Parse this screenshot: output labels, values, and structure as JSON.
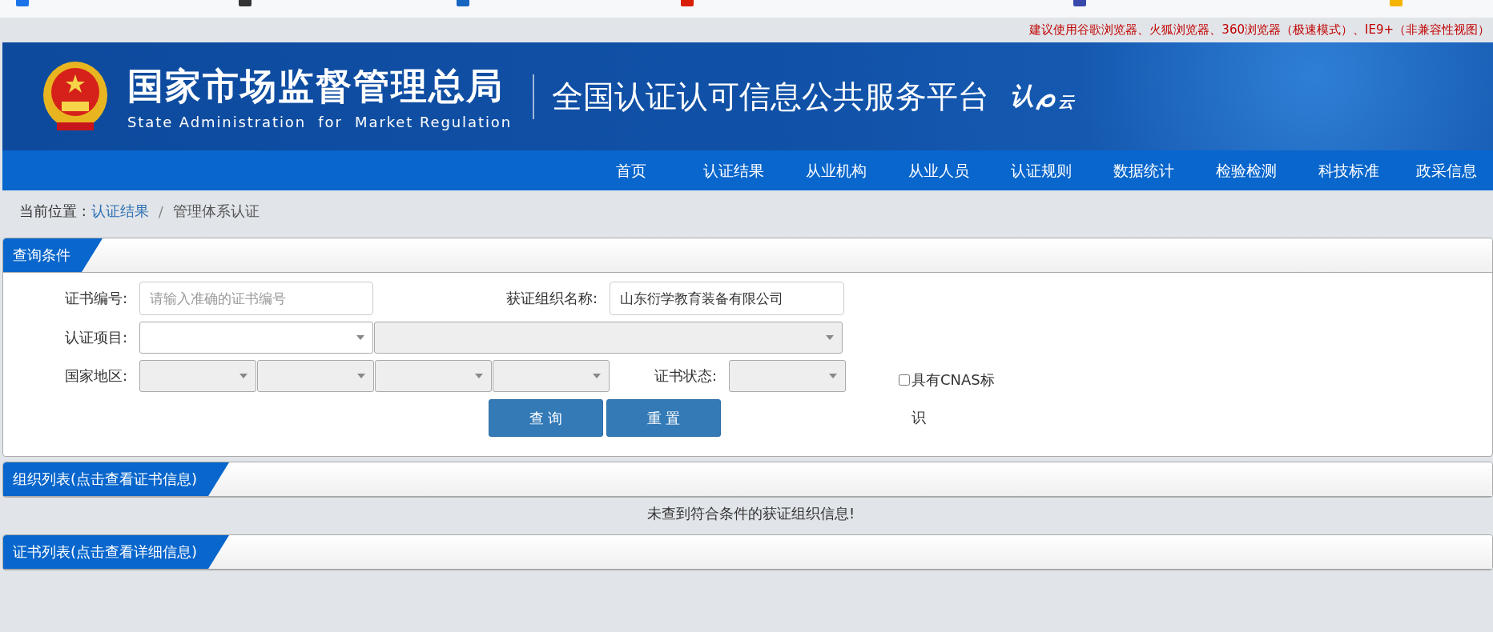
{
  "notice": "建议使用谷歌浏览器、火狐浏览器、360浏览器（极速模式）、IE9+（非兼容性视图）",
  "header": {
    "title": "国家市场监督管理总局",
    "subtitle": "State Administration  for  Market Regulation",
    "platform": "全国认证认可信息公共服务平台",
    "logo_text": [
      "认",
      "云"
    ]
  },
  "nav": [
    {
      "label": "首页"
    },
    {
      "label": "认证结果"
    },
    {
      "label": "从业机构"
    },
    {
      "label": "从业人员"
    },
    {
      "label": "认证规则"
    },
    {
      "label": "数据统计"
    },
    {
      "label": "检验检测"
    },
    {
      "label": "科技标准"
    },
    {
      "label": "政采信息"
    }
  ],
  "breadcrumb": {
    "prefix": "当前位置 :",
    "separator": "/",
    "items": [
      {
        "label": "认证结果",
        "kind": "link"
      },
      {
        "label": "管理体系认证",
        "kind": "current"
      }
    ]
  },
  "query_panel": {
    "title": "查询条件",
    "rows": [
      {
        "controls": [
          {
            "kind": "label",
            "text": "证书编号:"
          },
          {
            "kind": "input",
            "placeholder": "请输入准确的证书编号"
          },
          {
            "kind": "label",
            "text": "获证组织名称:"
          },
          {
            "kind": "input",
            "value": "山东衍学教育装备有限公司"
          }
        ]
      },
      {
        "controls": [
          {
            "kind": "label",
            "text": "认证项目:"
          },
          {
            "kind": "select",
            "disabled": false
          },
          {
            "kind": "select",
            "disabled": true
          }
        ]
      },
      {
        "controls": [
          {
            "kind": "label",
            "text": "国家地区:"
          },
          {
            "kind": "select",
            "disabled": true
          },
          {
            "kind": "select",
            "disabled": true
          },
          {
            "kind": "select",
            "disabled": true
          },
          {
            "kind": "select",
            "disabled": true
          },
          {
            "kind": "label",
            "text": "证书状态:"
          },
          {
            "kind": "select",
            "disabled": true
          }
        ]
      }
    ],
    "checkbox": {
      "label": "具有CNAS标识",
      "checked": false
    },
    "buttons": [
      {
        "label": "查 询"
      },
      {
        "label": "重 置"
      }
    ]
  },
  "org_list": {
    "title": "组织列表(点击查看证书信息)",
    "empty_message": "未查到符合条件的获证组织信息!"
  },
  "cert_list": {
    "title": "证书列表(点击查看详细信息)"
  }
}
